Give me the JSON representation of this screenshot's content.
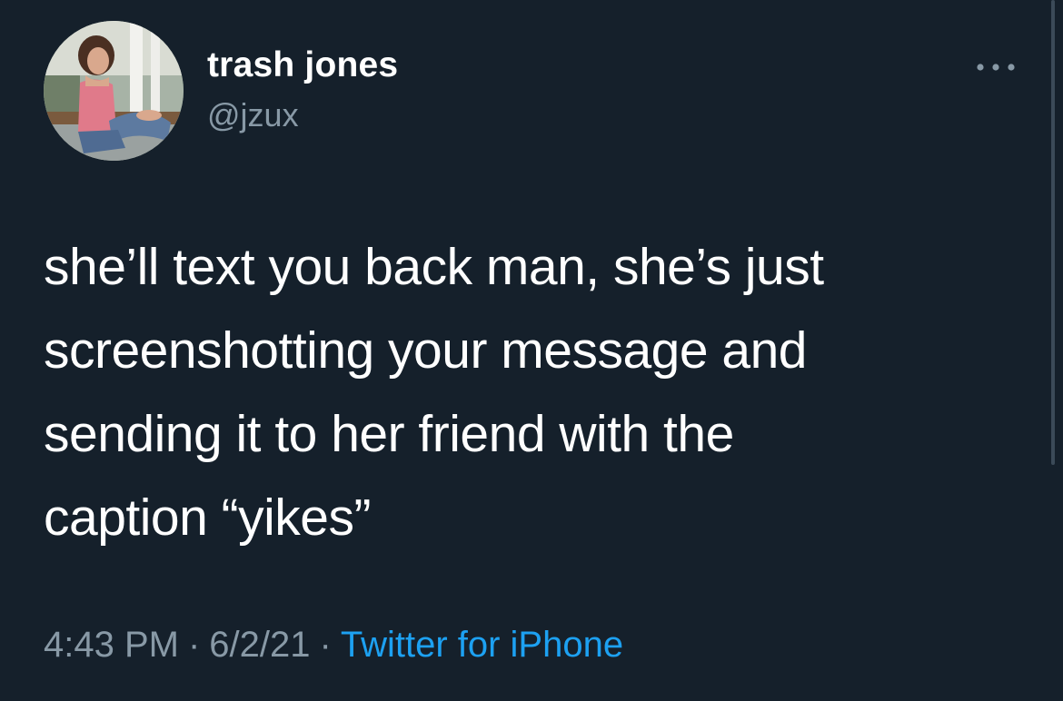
{
  "author": {
    "display_name": "trash jones",
    "handle": "@jzux"
  },
  "tweet": {
    "text_lines": [
      "she’ll text you back man, she’s just",
      "screenshotting your message and",
      "sending it to her friend with the",
      "caption “yikes”"
    ]
  },
  "meta": {
    "time": "4:43 PM",
    "date": "6/2/21",
    "separator": "·",
    "source": "Twitter for iPhone"
  },
  "colors": {
    "background": "#15202b",
    "text": "#ffffff",
    "secondary_text": "#8899a6",
    "link": "#1da1f2"
  },
  "icons": {
    "more": "more-horizontal-icon"
  }
}
